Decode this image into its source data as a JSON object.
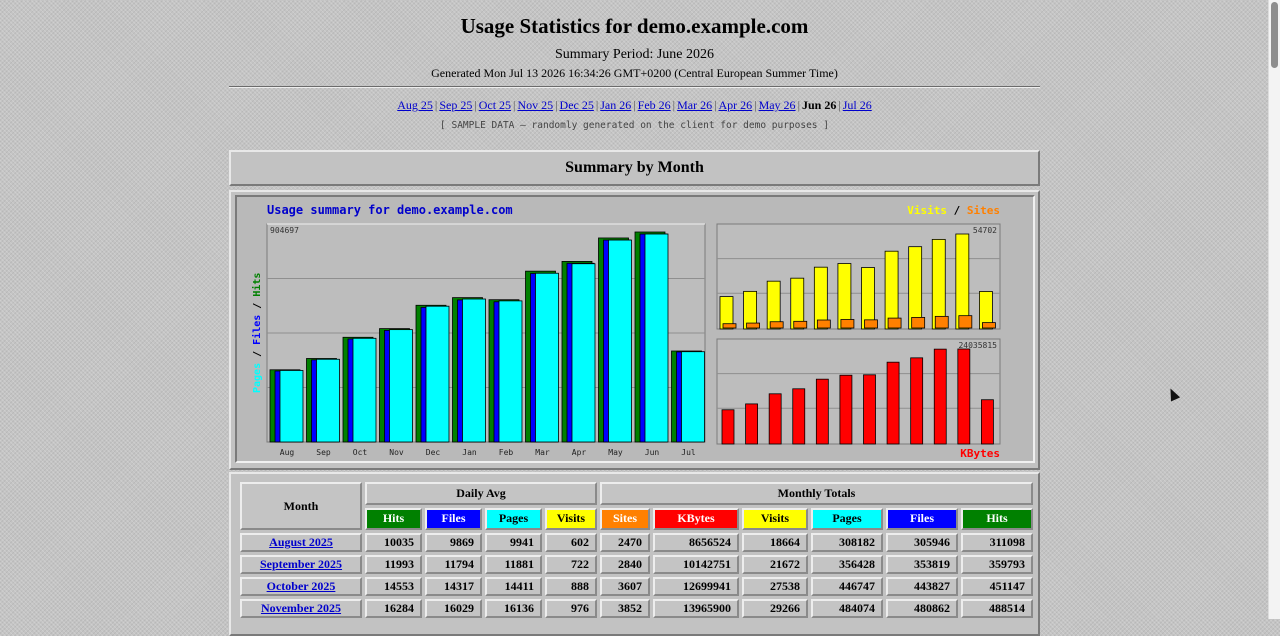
{
  "header": {
    "title": "Usage Statistics for demo.example.com",
    "period": "Summary Period: June 2026",
    "generated": "Generated Mon Jul 13 2026 16:34:26 GMT+0200 (Central European Summer Time)"
  },
  "months_nav": {
    "items": [
      "Aug 25",
      "Sep 25",
      "Oct 25",
      "Nov 25",
      "Dec 25",
      "Jan 26",
      "Feb 26",
      "Mar 26",
      "Apr 26",
      "May 26",
      "Jun 26",
      "Jul 26"
    ],
    "current": "Jun 26"
  },
  "sample_note": "[ SAMPLE DATA — randomly generated on the client for demo purposes ]",
  "summary_heading": "Summary by Month",
  "chart_data": [
    {
      "type": "bar",
      "title": "Usage summary for demo.example.com",
      "ylabel": "Pages / Files / Hits",
      "max_label": "904697",
      "categories": [
        "Aug",
        "Sep",
        "Oct",
        "Nov",
        "Dec",
        "Jan",
        "Feb",
        "Mar",
        "Apr",
        "May",
        "Jun",
        "Jul"
      ],
      "series": [
        {
          "name": "Hits",
          "color": "#008000",
          "values": [
            311098,
            359793,
            451147,
            488514,
            589000,
            622000,
            613000,
            736000,
            778000,
            879000,
            904697,
            392000
          ]
        },
        {
          "name": "Files",
          "color": "#0000ff",
          "values": [
            305946,
            353819,
            443827,
            480862,
            580000,
            612000,
            604000,
            726000,
            770000,
            870000,
            896000,
            388000
          ]
        },
        {
          "name": "Pages",
          "color": "#00ffff",
          "values": [
            308182,
            356428,
            446747,
            484074,
            585000,
            616000,
            608000,
            727000,
            768000,
            870000,
            896000,
            389000
          ]
        }
      ]
    },
    {
      "type": "bar",
      "legend": "Visits / Sites",
      "max_label": "54702",
      "categories": [
        "Aug",
        "Sep",
        "Oct",
        "Nov",
        "Dec",
        "Jan",
        "Feb",
        "Mar",
        "Apr",
        "May",
        "Jun",
        "Jul"
      ],
      "series": [
        {
          "name": "Visits",
          "color": "#ffff00",
          "values": [
            18664,
            21672,
            27538,
            29266,
            35600,
            37700,
            35400,
            44800,
            47400,
            51600,
            54702,
            21600
          ]
        },
        {
          "name": "Sites",
          "color": "#ff8000",
          "values": [
            2470,
            2840,
            3607,
            3852,
            4600,
            4900,
            4700,
            5700,
            6100,
            6700,
            7100,
            3100
          ]
        }
      ]
    },
    {
      "type": "bar",
      "legend": "KBytes",
      "max_label": "24035815",
      "categories": [
        "Aug",
        "Sep",
        "Oct",
        "Nov",
        "Dec",
        "Jan",
        "Feb",
        "Mar",
        "Apr",
        "May",
        "Jun",
        "Jul"
      ],
      "series": [
        {
          "name": "KBytes",
          "color": "#ff0000",
          "values": [
            8656524,
            10142751,
            12699941,
            13965900,
            16400000,
            17400000,
            17500000,
            20700000,
            21800000,
            24000000,
            24035815,
            11200000
          ]
        }
      ]
    }
  ],
  "table": {
    "month_header": "Month",
    "daily_avg_header": "Daily Avg",
    "monthly_totals_header": "Monthly Totals",
    "daily_cols": [
      "Hits",
      "Files",
      "Pages",
      "Visits"
    ],
    "total_cols": [
      "Sites",
      "KBytes",
      "Visits",
      "Pages",
      "Files",
      "Hits"
    ],
    "rows": [
      {
        "month": "August 2025",
        "daily": [
          "10035",
          "9869",
          "9941",
          "602"
        ],
        "totals": [
          "2470",
          "8656524",
          "18664",
          "308182",
          "305946",
          "311098"
        ]
      },
      {
        "month": "September 2025",
        "daily": [
          "11993",
          "11794",
          "11881",
          "722"
        ],
        "totals": [
          "2840",
          "10142751",
          "21672",
          "356428",
          "353819",
          "359793"
        ]
      },
      {
        "month": "October 2025",
        "daily": [
          "14553",
          "14317",
          "14411",
          "888"
        ],
        "totals": [
          "3607",
          "12699941",
          "27538",
          "446747",
          "443827",
          "451147"
        ]
      },
      {
        "month": "November 2025",
        "daily": [
          "16284",
          "16029",
          "16136",
          "976"
        ],
        "totals": [
          "3852",
          "13965900",
          "29266",
          "484074",
          "480862",
          "488514"
        ]
      }
    ]
  },
  "colors": {
    "hits": "#008000",
    "files": "#0000ff",
    "pages": "#00ffff",
    "visits": "#ffff00",
    "sites": "#ff8000",
    "kbytes": "#ff0000",
    "title_blue": "#0000cc"
  }
}
